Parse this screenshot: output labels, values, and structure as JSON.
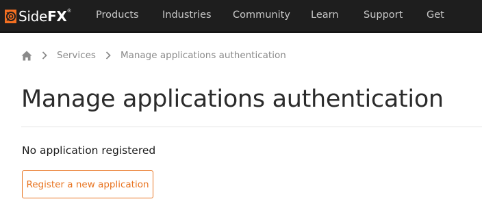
{
  "header": {
    "logo": {
      "brand_light": "Side",
      "brand_bold": "FX",
      "trademark": "®",
      "icon": "sidefx-logo-icon",
      "accent": "#f36f21"
    },
    "nav": [
      {
        "label": "Products"
      },
      {
        "label": "Industries"
      },
      {
        "label": "Community"
      },
      {
        "label": "Learn"
      },
      {
        "label": "Support"
      },
      {
        "label": "Get"
      }
    ]
  },
  "breadcrumb": {
    "home_icon": "home-icon",
    "items": [
      {
        "label": "Services"
      },
      {
        "label": "Manage applications authentication"
      }
    ]
  },
  "main": {
    "title": "Manage applications authentication",
    "status": "No application registered",
    "register_button": "Register a new application",
    "accent": "#e8731f"
  }
}
